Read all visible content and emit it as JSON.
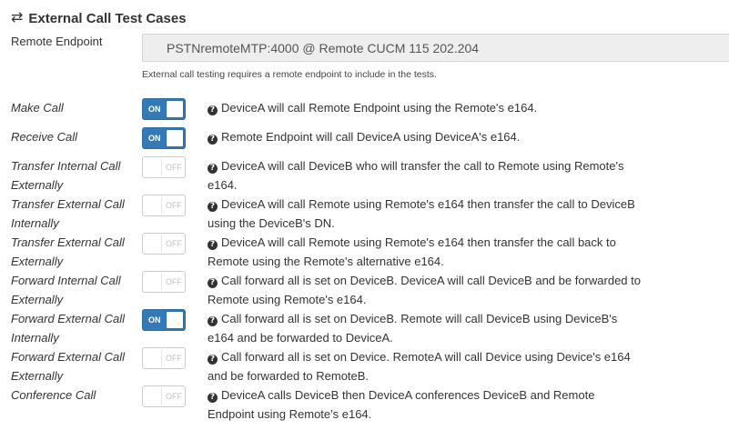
{
  "header": {
    "icon": "exchange-arrows-icon",
    "title": "External Call Test Cases"
  },
  "remote_endpoint": {
    "label": "Remote Endpoint",
    "value": "PSTNremoteMTP:4000 @ Remote CUCM 115 202.204",
    "help": "External call testing requires a remote endpoint to include in the tests."
  },
  "toggle_text": {
    "on": "ON",
    "off": "OFF"
  },
  "colors": {
    "toggle_on": "#337ab7",
    "text": "#333333"
  },
  "test_cases": [
    {
      "label": "Make Call",
      "enabled": true,
      "description": "DeviceA will call Remote Endpoint using the Remote's e164."
    },
    {
      "label": "Receive Call",
      "enabled": true,
      "description": "Remote Endpoint will call DeviceA using DeviceA's e164."
    },
    {
      "label": "Transfer Internal Call Externally",
      "enabled": false,
      "description": "DeviceA will call DeviceB who will transfer the call to Remote using Remote's e164."
    },
    {
      "label": "Transfer External Call Internally",
      "enabled": false,
      "description": "DeviceA will call Remote using Remote's e164 then transfer the call to DeviceB using the DeviceB's DN."
    },
    {
      "label": "Transfer External Call Externally",
      "enabled": false,
      "description": "DeviceA will call Remote using Remote's e164 then transfer the call back to Remote using the Remote's alternative e164."
    },
    {
      "label": "Forward Internal Call Externally",
      "enabled": false,
      "description": "Call forward all is set on DeviceB. DeviceA will call DeviceB and be forwarded to Remote using Remote's e164."
    },
    {
      "label": "Forward External Call Internally",
      "enabled": true,
      "description": "Call forward all is set on DeviceB. Remote will call DeviceB using DeviceB's e164 and be forwarded to DeviceA."
    },
    {
      "label": "Forward External Call Externally",
      "enabled": false,
      "description": "Call forward all is set on Device. RemoteA will call Device using Device's e164 and be forwarded to RemoteB."
    },
    {
      "label": "Conference Call",
      "enabled": false,
      "description": "DeviceA calls DeviceB then DeviceA conferences DeviceB and Remote Endpoint using Remote's e164."
    }
  ]
}
